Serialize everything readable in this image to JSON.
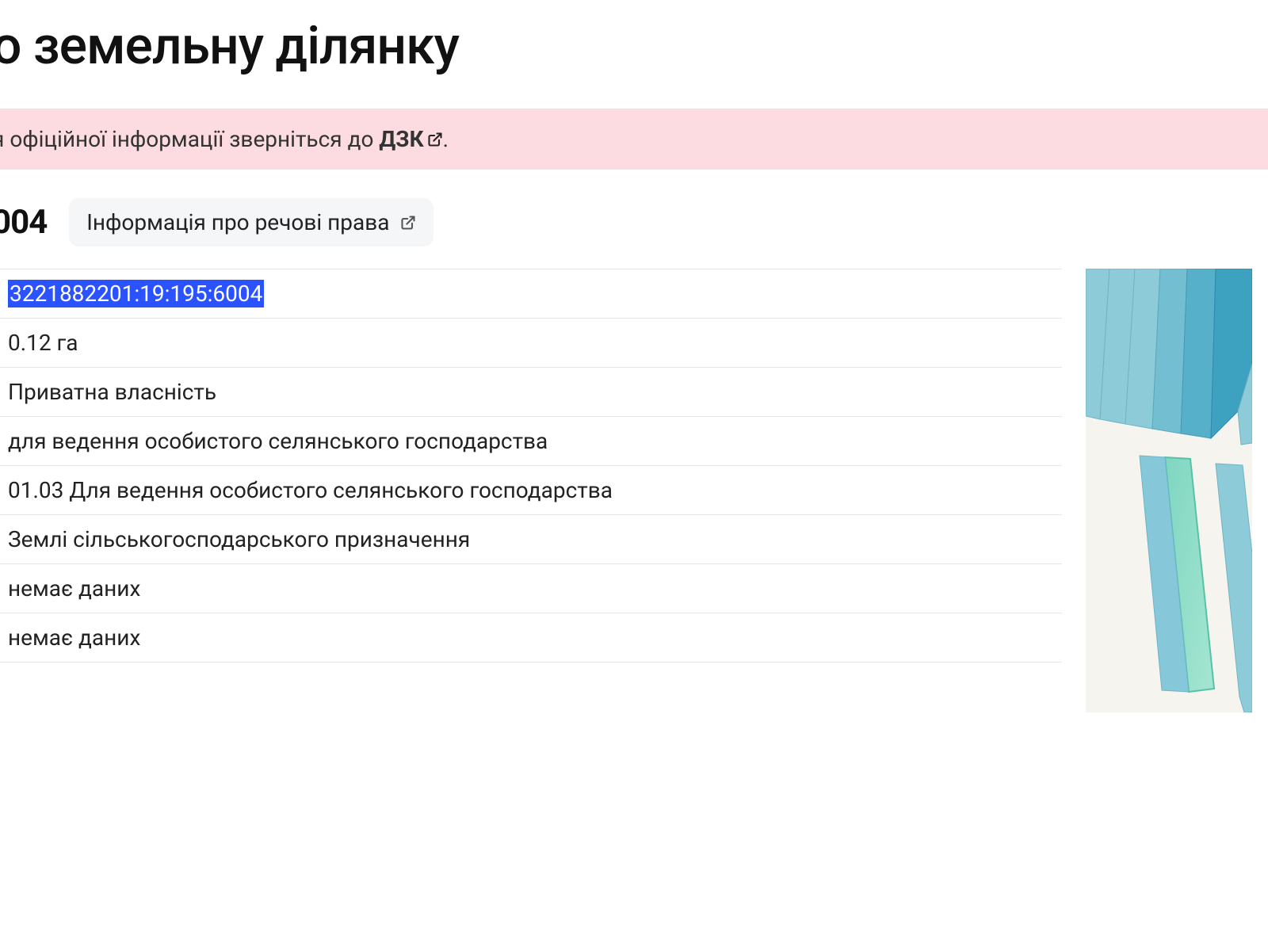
{
  "title": "о земельну ділянку",
  "notice": {
    "prefix": "я офіційної інформації зверніться до ",
    "link_text": "ДЗК",
    "suffix": "."
  },
  "header": {
    "id_fragment": "004",
    "rights_label": "Інформація про речові права"
  },
  "rows": [
    "3221882201:19:195:6004",
    "0.12 га",
    "Приватна власність",
    "для ведення особистого селянського господарства",
    "01.03 Для ведення особистого селянського господарства",
    "Землі сільськогосподарського призначення",
    "немає даних",
    "немає даних"
  ]
}
